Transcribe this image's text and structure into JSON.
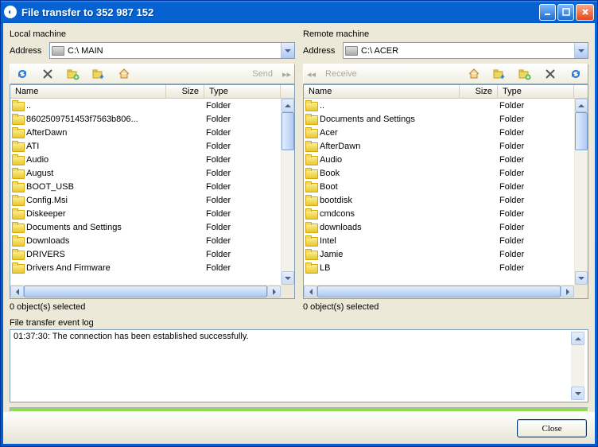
{
  "window": {
    "title": "File transfer to 352 987 152"
  },
  "local": {
    "title": "Local machine",
    "address_label": "Address",
    "drive": "C:\\  MAIN",
    "send_label": "Send",
    "columns": {
      "name": "Name",
      "size": "Size",
      "type": "Type"
    },
    "items": [
      {
        "name": "..",
        "type": "Folder"
      },
      {
        "name": "8602509751453f7563b806...",
        "type": "Folder"
      },
      {
        "name": "AfterDawn",
        "type": "Folder"
      },
      {
        "name": "ATI",
        "type": "Folder"
      },
      {
        "name": "Audio",
        "type": "Folder"
      },
      {
        "name": "August",
        "type": "Folder"
      },
      {
        "name": "BOOT_USB",
        "type": "Folder"
      },
      {
        "name": "Config.Msi",
        "type": "Folder"
      },
      {
        "name": "Diskeeper",
        "type": "Folder"
      },
      {
        "name": "Documents and Settings",
        "type": "Folder"
      },
      {
        "name": "Downloads",
        "type": "Folder"
      },
      {
        "name": "DRIVERS",
        "type": "Folder"
      },
      {
        "name": "Drivers And Firmware",
        "type": "Folder"
      }
    ],
    "status": "0 object(s) selected"
  },
  "remote": {
    "title": "Remote machine",
    "address_label": "Address",
    "drive": "C:\\  ACER",
    "receive_label": "Receive",
    "columns": {
      "name": "Name",
      "size": "Size",
      "type": "Type"
    },
    "items": [
      {
        "name": "..",
        "type": "Folder"
      },
      {
        "name": "Documents and Settings",
        "type": "Folder"
      },
      {
        "name": "Acer",
        "type": "Folder"
      },
      {
        "name": "AfterDawn",
        "type": "Folder"
      },
      {
        "name": "Audio",
        "type": "Folder"
      },
      {
        "name": "Book",
        "type": "Folder"
      },
      {
        "name": "Boot",
        "type": "Folder"
      },
      {
        "name": "bootdisk",
        "type": "Folder"
      },
      {
        "name": "cmdcons",
        "type": "Folder"
      },
      {
        "name": "downloads",
        "type": "Folder"
      },
      {
        "name": "Intel",
        "type": "Folder"
      },
      {
        "name": "Jamie",
        "type": "Folder"
      },
      {
        "name": "LB",
        "type": "Folder"
      }
    ],
    "status": "0 object(s) selected"
  },
  "log": {
    "label": "File transfer event log",
    "entry": "01:37:30: The connection has been established successfully."
  },
  "close_label": "Close"
}
